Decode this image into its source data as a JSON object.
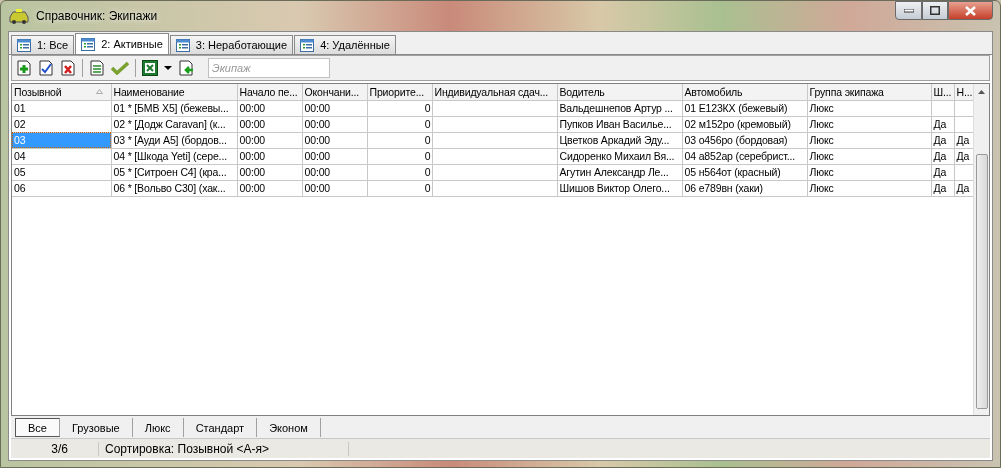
{
  "window": {
    "title": "Справочник: Экипажи"
  },
  "tabs": [
    {
      "label": "1: Все",
      "selected": false
    },
    {
      "label": "2: Активные",
      "selected": true
    },
    {
      "label": "3: Неработающие",
      "selected": false
    },
    {
      "label": "4: Удалённые",
      "selected": false
    }
  ],
  "search": {
    "placeholder": "Экипаж"
  },
  "table": {
    "columns": [
      {
        "label": "Позывной",
        "sorted": true
      },
      {
        "label": "Наименование",
        "sorted": false
      },
      {
        "label": "Начало пе...",
        "sorted": false
      },
      {
        "label": "Окончани...",
        "sorted": false
      },
      {
        "label": "Приорите...",
        "sorted": false
      },
      {
        "label": "Индивидуальная сдач...",
        "sorted": false
      },
      {
        "label": "Водитель",
        "sorted": false
      },
      {
        "label": "Автомобиль",
        "sorted": false
      },
      {
        "label": "Группа экипажа",
        "sorted": false
      },
      {
        "label": "Ш...",
        "sorted": false
      },
      {
        "label": "Н...",
        "sorted": false
      }
    ],
    "rows": [
      {
        "selected": false,
        "cells": [
          "01",
          "01 * [БМВ X5] (бежевы...",
          "00:00",
          "00:00",
          "0",
          "",
          "Вальдешнепов Артур ...",
          "01 Е123КХ (бежевый)",
          "Люкс",
          "",
          ""
        ]
      },
      {
        "selected": false,
        "cells": [
          "02",
          "02 * [Додж Caravan] (к...",
          "00:00",
          "00:00",
          "0",
          "",
          "Пупков Иван Василье...",
          "02 м152ро (кремовый)",
          "Люкс",
          "Да",
          ""
        ]
      },
      {
        "selected": true,
        "cells": [
          "03",
          "03 * [Ауди А5] (бордов...",
          "00:00",
          "00:00",
          "0",
          "",
          "Цветков Аркадий Эду...",
          "03 о456ро (бордовая)",
          "Люкс",
          "Да",
          "Да"
        ]
      },
      {
        "selected": false,
        "cells": [
          "04",
          "04 * [Шкода Yeti] (сере...",
          "00:00",
          "00:00",
          "0",
          "",
          "Сидоренко Михаил Вя...",
          "04 а852ар (серебрист...",
          "Люкс",
          "Да",
          "Да"
        ]
      },
      {
        "selected": false,
        "cells": [
          "05",
          "05 * [Ситроен С4] (кра...",
          "00:00",
          "00:00",
          "0",
          "",
          "Агутин Александр Ле...",
          "05 н564от (красный)",
          "Люкс",
          "Да",
          ""
        ]
      },
      {
        "selected": false,
        "cells": [
          "06",
          "06 * [Вольво С30] (хак...",
          "00:00",
          "00:00",
          "0",
          "",
          "Шишов Виктор Олего...",
          "06 е789вн (хаки)",
          "Люкс",
          "Да",
          "Да"
        ]
      }
    ]
  },
  "group_tabs": [
    {
      "label": "Все",
      "selected": true
    },
    {
      "label": "Грузовые",
      "selected": false
    },
    {
      "label": "Люкс",
      "selected": false
    },
    {
      "label": "Стандарт",
      "selected": false
    },
    {
      "label": "Эконом",
      "selected": false
    }
  ],
  "status_bar": {
    "count": "3/6",
    "sorting": "Сортировка: Позывной <А-я>"
  }
}
